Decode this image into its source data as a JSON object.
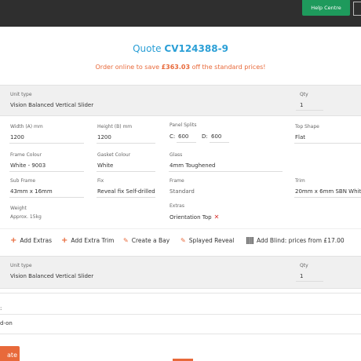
{
  "header": {
    "help_label": "Help Centre"
  },
  "quote": {
    "prefix": "Quote",
    "number": "CV124388-9",
    "promo_before": "Order online to save",
    "promo_amount": "£363.03",
    "promo_after": "off the standard prices!"
  },
  "item1": {
    "unit_type_label": "Unit type",
    "unit_type": "Vision Balanced Vertical Slider",
    "qty_label": "Qty",
    "qty": "1",
    "width_label": "Width (A) mm",
    "width": "1200",
    "height_label": "Height (B) mm",
    "height": "1200",
    "panel_splits_label": "Panel Splits",
    "split_c_label": "C:",
    "split_c": "600",
    "split_d_label": "D:",
    "split_d": "600",
    "top_shape_label": "Top Shape",
    "top_shape": "Flat",
    "frame_colour_label": "Frame Colour",
    "frame_colour": "White - 9003",
    "gasket_colour_label": "Gasket Colour",
    "gasket_colour": "White",
    "glass_label": "Glass",
    "glass": "4mm Toughened",
    "sub_frame_label": "Sub Frame",
    "sub_frame": "43mm x 16mm",
    "fix_label": "Fix",
    "fix": "Reveal fix Self-drilled",
    "frame_label": "Frame",
    "frame": "Standard",
    "trim_label": "Trim",
    "trim": "20mm x 6mm SBN White",
    "weight_label": "Weight",
    "weight": "Approx. 15kg",
    "extras_label": "Extras",
    "extras": "Orientation Top"
  },
  "actions": {
    "add_extras": "Add Extras",
    "add_extra_trim": "Add Extra Trim",
    "create_bay": "Create a Bay",
    "splayed_reveal": "Splayed Reveal",
    "add_blind": "Add Blind: prices from £17.00"
  },
  "item2": {
    "unit_type_label": "Unit type",
    "unit_type": "Vision Balanced Vertical Slider",
    "qty_label": "Qty",
    "qty": "1"
  },
  "footer": {
    "partial_colon": ":",
    "partial_text": "d-on",
    "button_partial": "ate"
  }
}
